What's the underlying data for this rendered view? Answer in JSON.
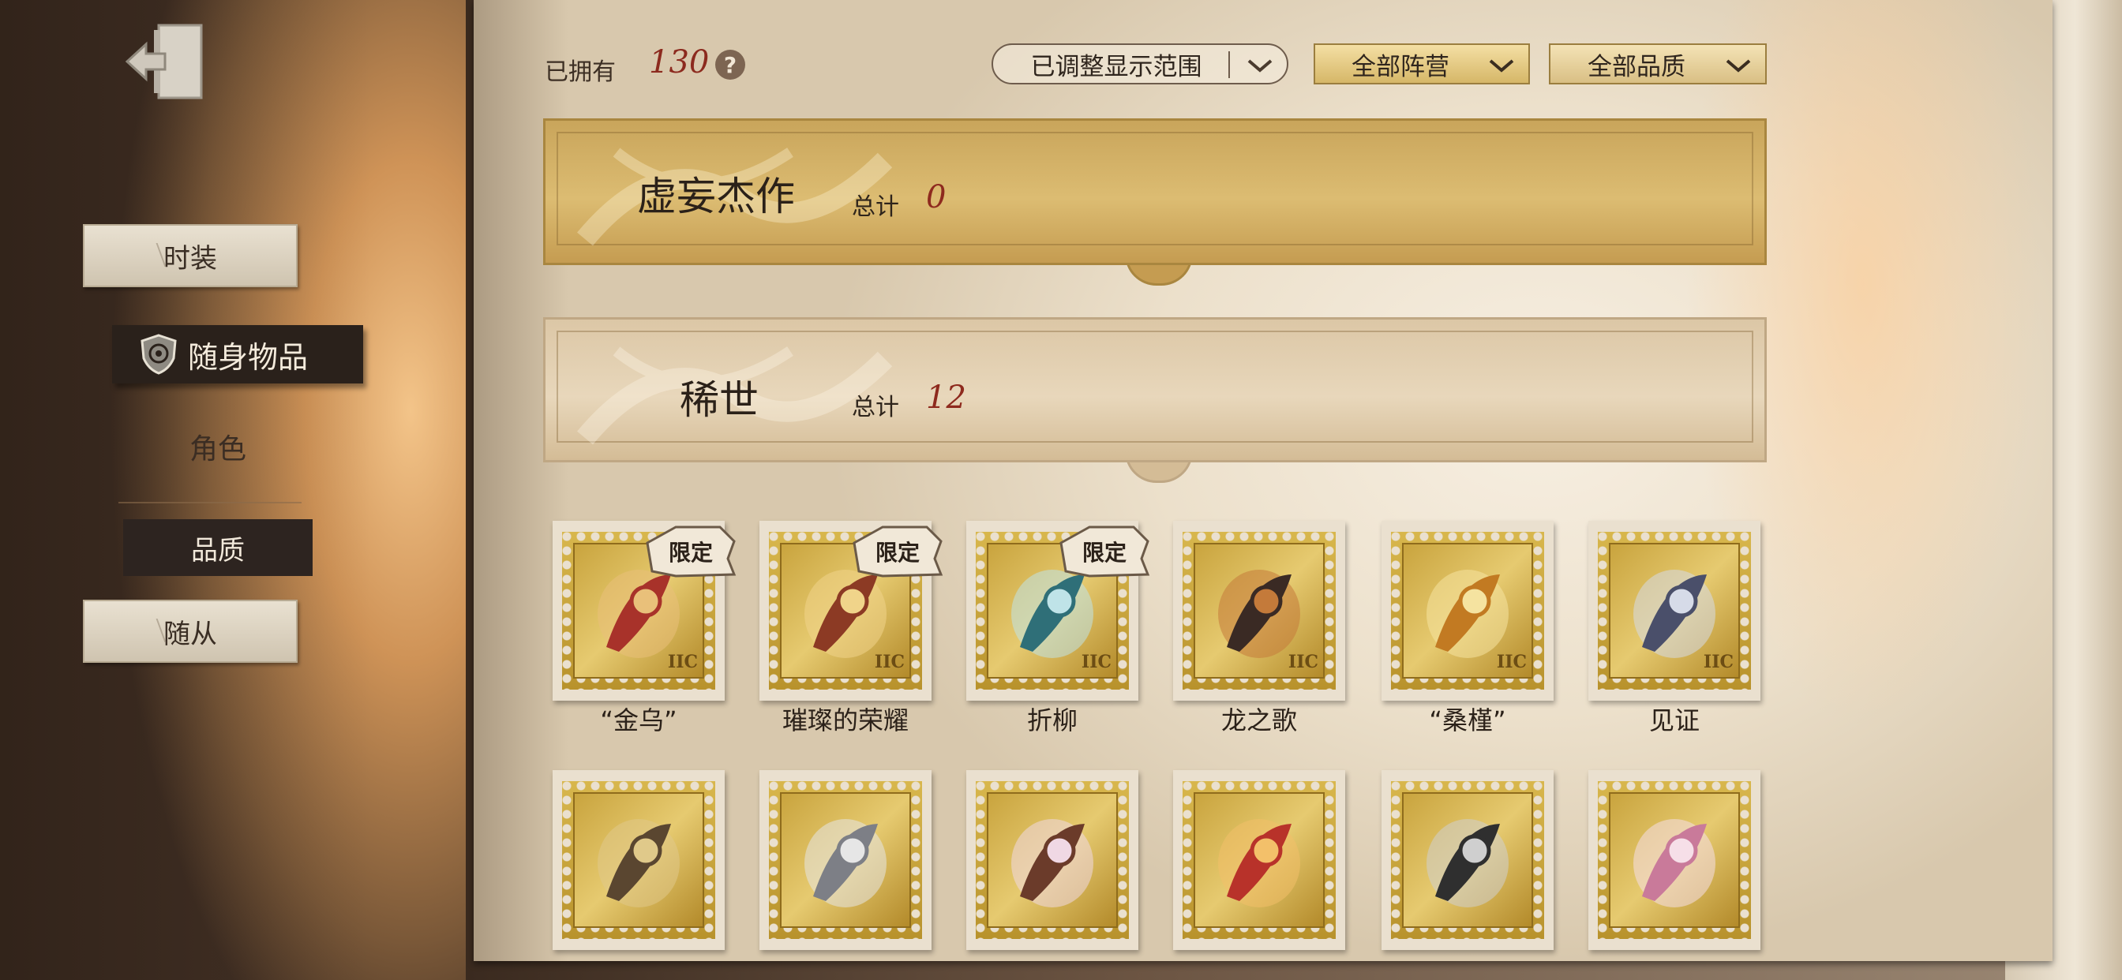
{
  "sidebar": {
    "tabs": [
      {
        "label": "时装"
      },
      {
        "label": "随身物品"
      },
      {
        "label": "角色"
      },
      {
        "label": "品质"
      },
      {
        "label": "随从"
      }
    ]
  },
  "header": {
    "owned_label": "已拥有",
    "owned_count": "130",
    "help_symbol": "?",
    "filters": [
      "已调整显示范围",
      "全部阵营",
      "全部品质"
    ]
  },
  "groups": [
    {
      "title": "虚妄杰作",
      "total_label": "总计",
      "total": "0"
    },
    {
      "title": "稀世",
      "total_label": "总计",
      "total": "12"
    }
  ],
  "items": [
    {
      "name": "“金乌”",
      "tag": "限定",
      "icon": "lantern-icon"
    },
    {
      "name": "璀璨的荣耀",
      "tag": "限定",
      "icon": "trophy-icon"
    },
    {
      "name": "折柳",
      "tag": "限定",
      "icon": "vase-icon"
    },
    {
      "name": "龙之歌",
      "tag": "",
      "icon": "harp-icon"
    },
    {
      "name": "“桑槿”",
      "tag": "",
      "icon": "flower-icon"
    },
    {
      "name": "见证",
      "tag": "",
      "icon": "book-icon"
    },
    {
      "name": "",
      "tag": "",
      "icon": "scroll-icon"
    },
    {
      "name": "",
      "tag": "",
      "icon": "winged-helmet-icon"
    },
    {
      "name": "",
      "tag": "",
      "icon": "doll-icon"
    },
    {
      "name": "",
      "tag": "",
      "icon": "phoenix-icon"
    },
    {
      "name": "",
      "tag": "",
      "icon": "scythe-icon"
    },
    {
      "name": "",
      "tag": "",
      "icon": "blossom-icon"
    }
  ],
  "colors": {
    "accent_red": "#8e2a1e",
    "gold": "#d6b768",
    "dark_tab": "#2a211b"
  }
}
